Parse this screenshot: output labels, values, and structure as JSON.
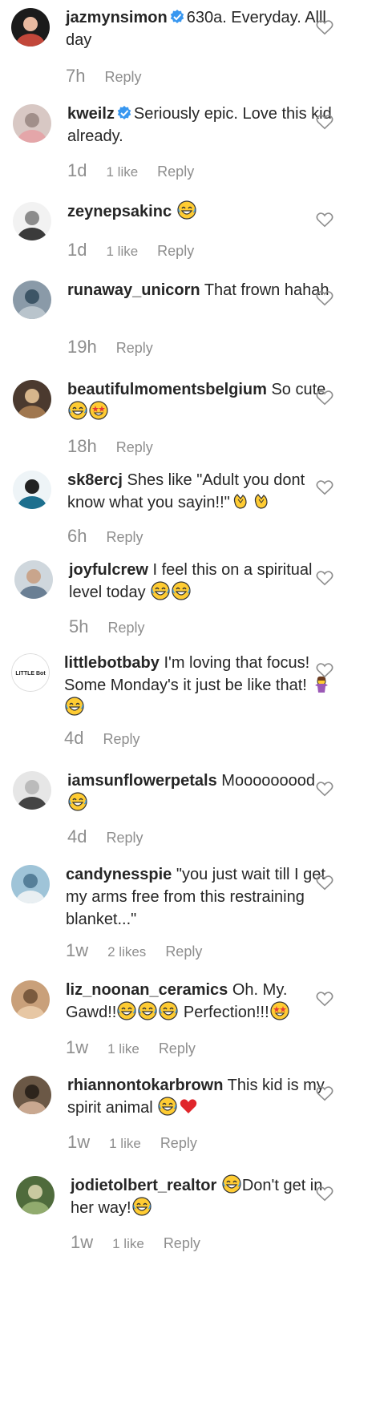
{
  "comments": [
    {
      "username": "jazmynsimon",
      "verified": true,
      "text": "630a. Everyday. Alll day",
      "time": "7h",
      "likes": "",
      "reply": "Reply"
    },
    {
      "username": "kweilz",
      "verified": true,
      "text": "Seriously epic. Love this kid already.",
      "time": "1d",
      "likes": "1 like",
      "reply": "Reply"
    },
    {
      "username": "zeynepsakinc",
      "verified": false,
      "text": "😂",
      "time": "1d",
      "likes": "1 like",
      "reply": "Reply"
    },
    {
      "username": "runaway_unicorn",
      "verified": false,
      "text": "That frown hahah",
      "time": "19h",
      "likes": "",
      "reply": "Reply"
    },
    {
      "username": "beautifulmomentsbelgium",
      "verified": false,
      "text": "So cute 😂🤩",
      "time": "18h",
      "likes": "",
      "reply": "Reply"
    },
    {
      "username": "sk8ercj",
      "verified": false,
      "text": "Shes like \"Adult you dont know what you sayin!!\"👏👏",
      "time": "6h",
      "likes": "",
      "reply": "Reply"
    },
    {
      "username": "joyfulcrew",
      "verified": false,
      "text": "I feel this on a spiritual level today 😂😂",
      "time": "5h",
      "likes": "",
      "reply": "Reply"
    },
    {
      "username": "littlebotbaby",
      "verified": false,
      "text": "I'm loving that focus! Some Monday's it just be like that! 🤷‍♀️ 😂",
      "time": "4d",
      "likes": "",
      "reply": "Reply",
      "avatar_text": "LITTLE Bot"
    },
    {
      "username": "iamsunflowerpetals",
      "verified": false,
      "text": "Mooooooood 😂",
      "time": "4d",
      "likes": "",
      "reply": "Reply"
    },
    {
      "username": "candynesspie",
      "verified": false,
      "text": "\"you just wait till I get my arms free from this restraining blanket...\"",
      "time": "1w",
      "likes": "2 likes",
      "reply": "Reply"
    },
    {
      "username": "liz_noonan_ceramics",
      "verified": false,
      "text": "Oh. My. Gawd!!😂😂😂 Perfection!!!🤩",
      "time": "1w",
      "likes": "1 like",
      "reply": "Reply"
    },
    {
      "username": "rhiannontokarbrown",
      "verified": false,
      "text": "This kid is my spirit animal 😂❤️",
      "time": "1w",
      "likes": "1 like",
      "reply": "Reply"
    },
    {
      "username": "jodietolbert_realtor",
      "verified": false,
      "text": "😂Don't get in her way!🤣",
      "time": "1w",
      "likes": "1 like",
      "reply": "Reply"
    }
  ],
  "colors": {
    "text": "#262626",
    "meta": "#8e8e8e",
    "verified": "#3897f0",
    "heart_stroke": "#8e8e8e"
  },
  "icons": {
    "heart": "heart-outline-icon",
    "verified": "verified-badge-icon"
  }
}
